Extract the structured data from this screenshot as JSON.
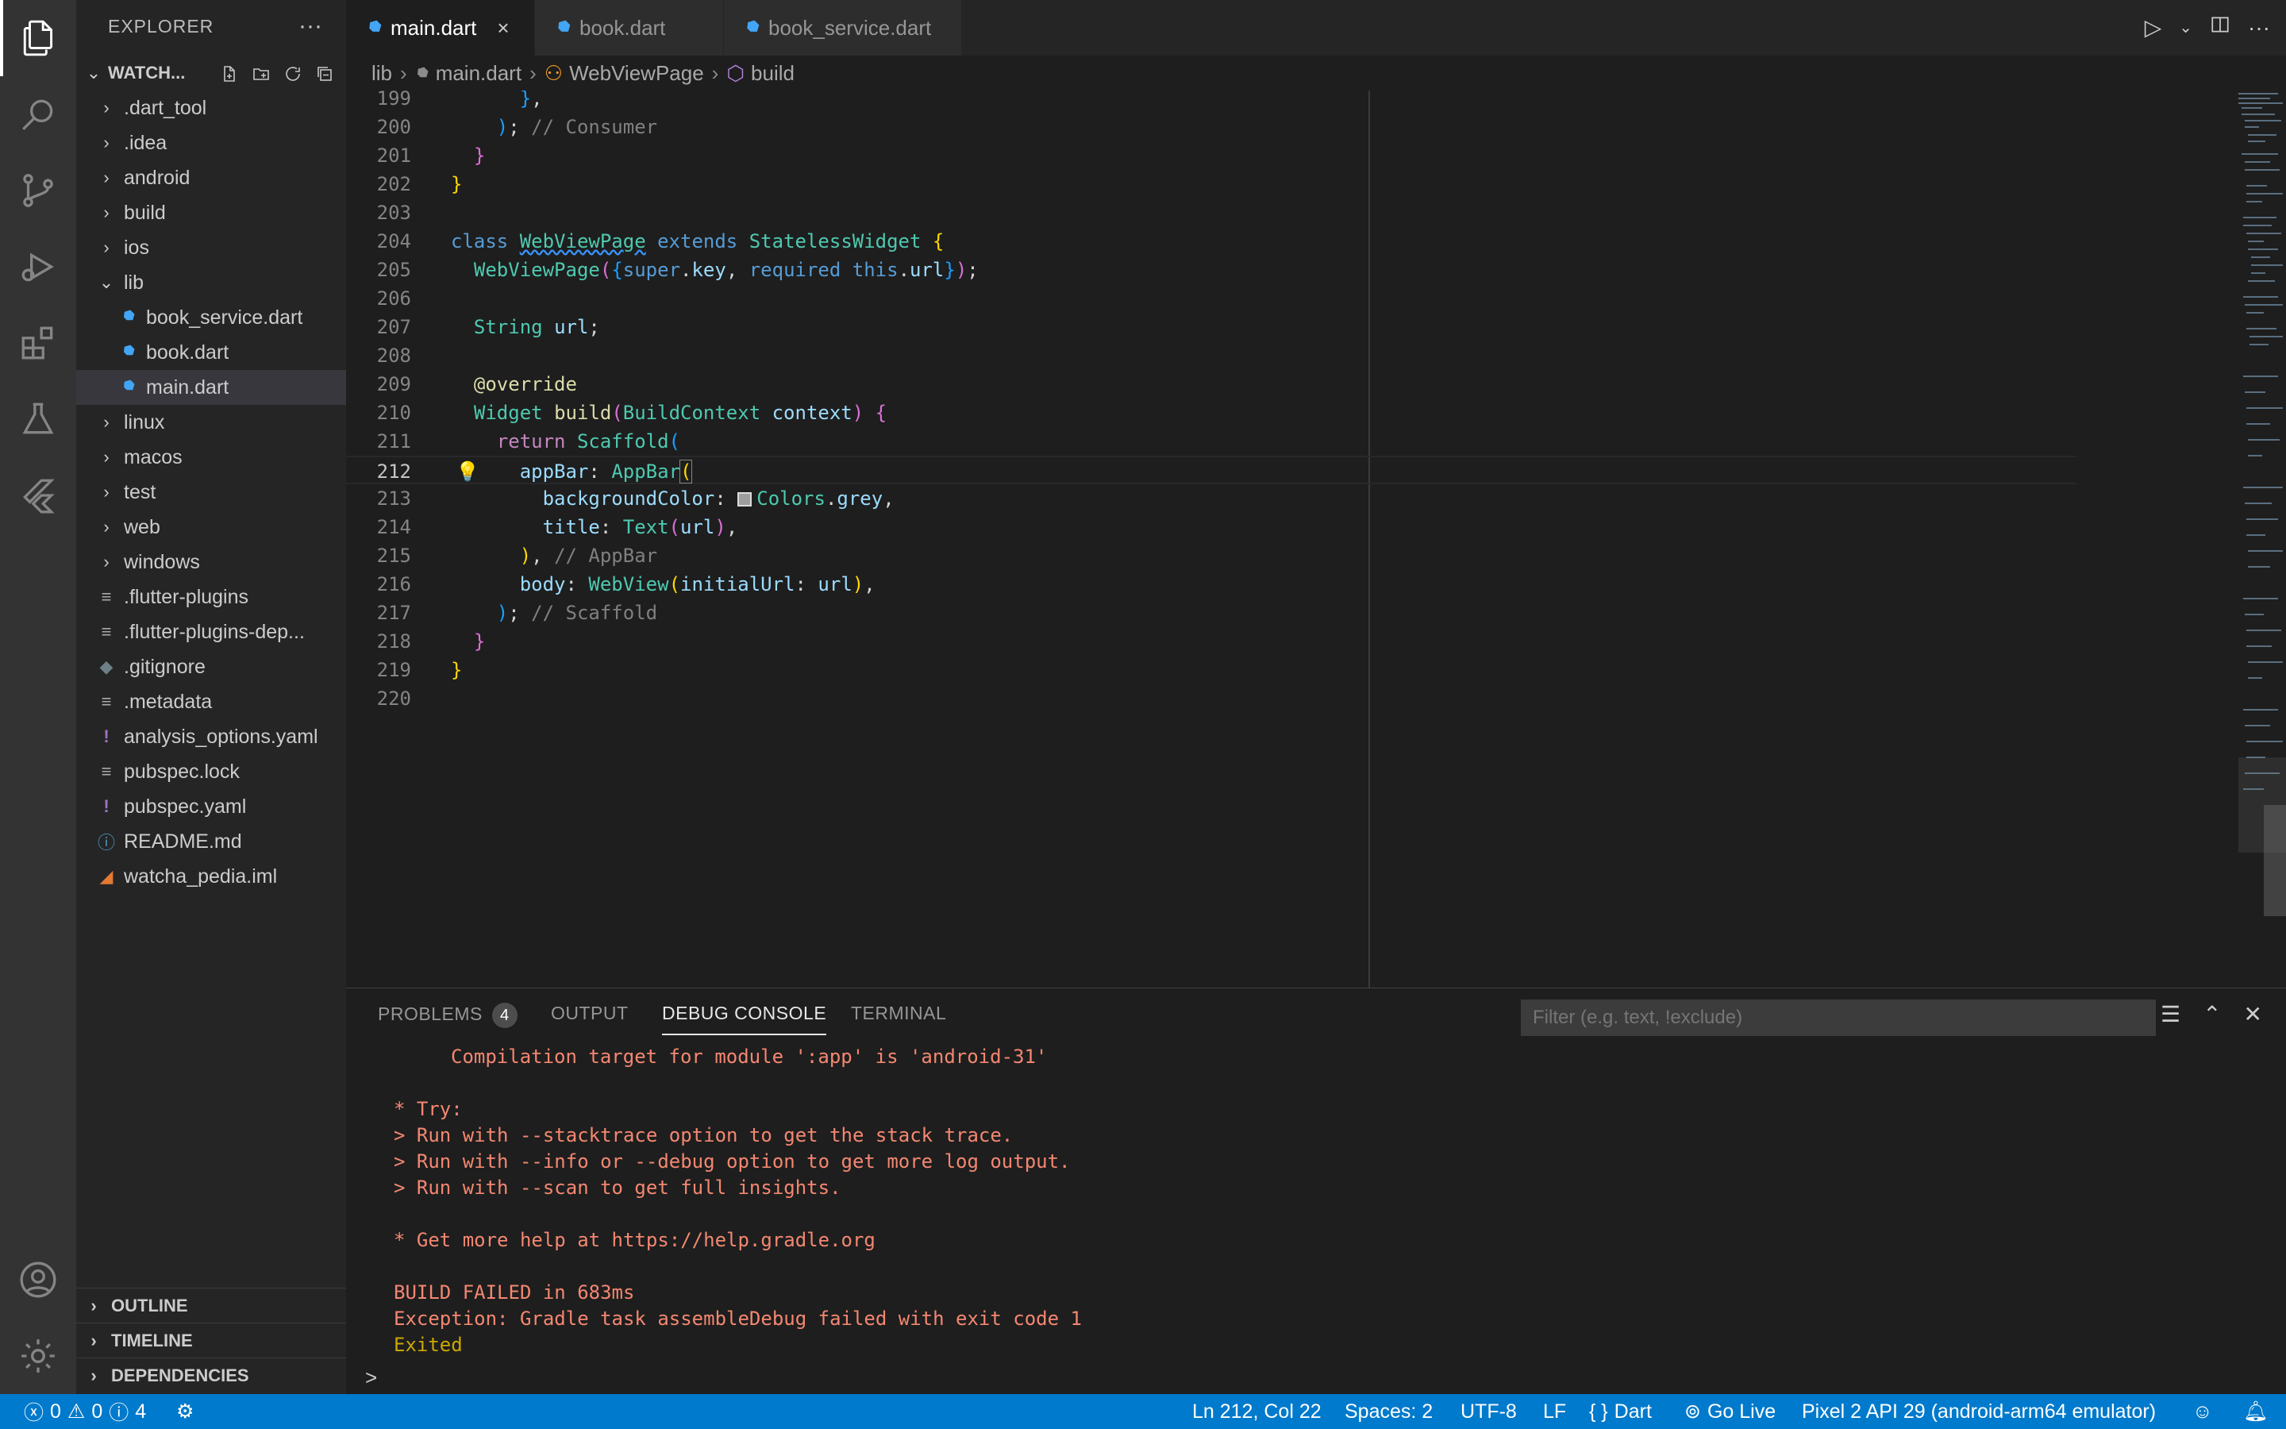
{
  "sidebar": {
    "title": "EXPLORER",
    "more": "···",
    "workspace": "WATCH...",
    "items": [
      {
        "label": ".dart_tool",
        "type": "folder"
      },
      {
        "label": ".idea",
        "type": "folder"
      },
      {
        "label": "android",
        "type": "folder"
      },
      {
        "label": "build",
        "type": "folder"
      },
      {
        "label": "ios",
        "type": "folder"
      },
      {
        "label": "lib",
        "type": "folder-open"
      },
      {
        "label": "book_service.dart",
        "type": "dart"
      },
      {
        "label": "book.dart",
        "type": "dart"
      },
      {
        "label": "main.dart",
        "type": "dart"
      },
      {
        "label": "linux",
        "type": "folder"
      },
      {
        "label": "macos",
        "type": "folder"
      },
      {
        "label": "test",
        "type": "folder"
      },
      {
        "label": "web",
        "type": "folder"
      },
      {
        "label": "windows",
        "type": "folder"
      },
      {
        "label": ".flutter-plugins",
        "type": "file"
      },
      {
        "label": ".flutter-plugins-dep...",
        "type": "file"
      },
      {
        "label": ".gitignore",
        "type": "git"
      },
      {
        "label": ".metadata",
        "type": "file"
      },
      {
        "label": "analysis_options.yaml",
        "type": "yaml"
      },
      {
        "label": "pubspec.lock",
        "type": "file"
      },
      {
        "label": "pubspec.yaml",
        "type": "yaml"
      },
      {
        "label": "README.md",
        "type": "info"
      },
      {
        "label": "watcha_pedia.iml",
        "type": "rss"
      }
    ],
    "sections": [
      "OUTLINE",
      "TIMELINE",
      "DEPENDENCIES"
    ]
  },
  "tabs": [
    {
      "label": "main.dart",
      "close": "×"
    },
    {
      "label": "book.dart"
    },
    {
      "label": "book_service.dart"
    }
  ],
  "breadcrumbs": [
    "lib",
    "main.dart",
    "WebViewPage",
    "build"
  ],
  "editor": {
    "lines": [
      {
        "n": "199",
        "t": "      },"
      },
      {
        "n": "200",
        "t": "    ); // Consumer"
      },
      {
        "n": "201",
        "t": "  }"
      },
      {
        "n": "202",
        "t": "}"
      },
      {
        "n": "203",
        "t": ""
      },
      {
        "n": "204",
        "t": "class WebViewPage extends StatelessWidget {"
      },
      {
        "n": "205",
        "t": "  WebViewPage({super.key, required this.url});"
      },
      {
        "n": "206",
        "t": ""
      },
      {
        "n": "207",
        "t": "  String url;"
      },
      {
        "n": "208",
        "t": ""
      },
      {
        "n": "209",
        "t": "  @override"
      },
      {
        "n": "210",
        "t": "  Widget build(BuildContext context) {"
      },
      {
        "n": "211",
        "t": "    return Scaffold("
      },
      {
        "n": "212",
        "t": "      appBar: AppBar("
      },
      {
        "n": "213",
        "t": "        backgroundColor: Colors.grey,"
      },
      {
        "n": "214",
        "t": "        title: Text(url),"
      },
      {
        "n": "215",
        "t": "      ), // AppBar"
      },
      {
        "n": "216",
        "t": "      body: WebView(initialUrl: url),"
      },
      {
        "n": "217",
        "t": "    ); // Scaffold"
      },
      {
        "n": "218",
        "t": "  }"
      },
      {
        "n": "219",
        "t": "}"
      },
      {
        "n": "220",
        "t": ""
      }
    ]
  },
  "panel": {
    "tabs": [
      "PROBLEMS",
      "OUTPUT",
      "DEBUG CONSOLE",
      "TERMINAL"
    ],
    "problems_count": "4",
    "filter_placeholder": "Filter (e.g. text, !exclude)",
    "console": [
      "Compilation target for module ':app' is 'android-31'",
      "",
      "* Try:",
      "> Run with --stacktrace option to get the stack trace.",
      "> Run with --info or --debug option to get more log output.",
      "> Run with --scan to get full insights.",
      "",
      "* Get more help at https://help.gradle.org",
      "",
      "BUILD FAILED in 683ms",
      "Exception: Gradle task assembleDebug failed with exit code 1",
      "Exited"
    ],
    "prompt": ">"
  },
  "status": {
    "errors": "0",
    "warnings": "0",
    "infos": "4",
    "position": "Ln 212, Col 22",
    "spaces": "Spaces: 2",
    "encoding": "UTF-8",
    "eol": "LF",
    "language": "Dart",
    "language_icon": "{ }",
    "golive": "Go Live",
    "device": "Pixel 2 API 29 (android-arm64 emulator)"
  },
  "colors": {
    "status_bar": "#007acc",
    "error_text": "#f48771",
    "dart_icon": "#42a5f5"
  }
}
